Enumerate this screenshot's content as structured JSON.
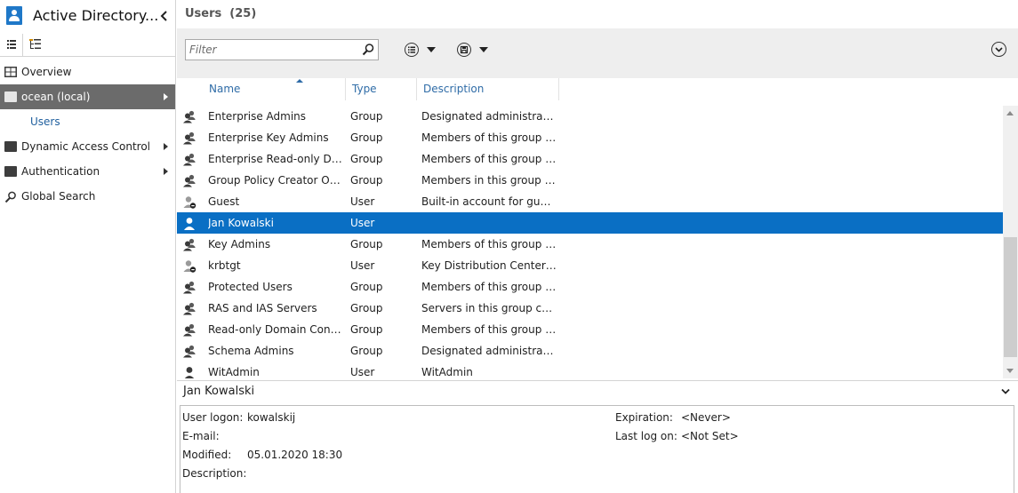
{
  "nav": {
    "title": "Active Directory...",
    "items": [
      {
        "label": "Overview"
      },
      {
        "label": "ocean (local)"
      },
      {
        "label": "Users"
      },
      {
        "label": "Dynamic Access Control"
      },
      {
        "label": "Authentication"
      },
      {
        "label": "Global Search"
      }
    ]
  },
  "header": {
    "title": "Users  (25)"
  },
  "toolbar": {
    "filter_placeholder": "Filter"
  },
  "columns": [
    "Name",
    "Type",
    "Description"
  ],
  "rows": [
    {
      "name": "Enterprise Admins",
      "type": "Group",
      "description": "Designated administrators...",
      "icon": "group-icon"
    },
    {
      "name": "Enterprise Key Admins",
      "type": "Group",
      "description": "Members of this group ca...",
      "icon": "group-icon"
    },
    {
      "name": "Enterprise Read-only Dom...",
      "type": "Group",
      "description": "Members of this group ar...",
      "icon": "group-icon"
    },
    {
      "name": "Group Policy Creator Own...",
      "type": "Group",
      "description": "Members in this group ca...",
      "icon": "group-icon"
    },
    {
      "name": "Guest",
      "type": "User",
      "description": "Built-in account for guest...",
      "icon": "disabled-user-icon"
    },
    {
      "name": "Jan Kowalski",
      "type": "User",
      "description": "",
      "icon": "user-icon",
      "selected": true
    },
    {
      "name": "Key Admins",
      "type": "Group",
      "description": "Members of this group ca...",
      "icon": "group-icon"
    },
    {
      "name": "krbtgt",
      "type": "User",
      "description": "Key Distribution Center Se...",
      "icon": "disabled-user-icon"
    },
    {
      "name": "Protected Users",
      "type": "Group",
      "description": "Members of this group ar...",
      "icon": "group-icon"
    },
    {
      "name": "RAS and IAS Servers",
      "type": "Group",
      "description": "Servers in this group can a...",
      "icon": "group-icon"
    },
    {
      "name": "Read-only Domain Control...",
      "type": "Group",
      "description": "Members of this group ar...",
      "icon": "group-icon"
    },
    {
      "name": "Schema Admins",
      "type": "Group",
      "description": "Designated administrators...",
      "icon": "group-icon"
    },
    {
      "name": "WitAdmin",
      "type": "User",
      "description": "WitAdmin",
      "icon": "user-icon"
    }
  ],
  "detail": {
    "title": "Jan Kowalski",
    "user_logon_label": "User logon:",
    "user_logon": "kowalskij",
    "email_label": "E-mail:",
    "email": "",
    "modified_label": "Modified:",
    "modified": "05.01.2020 18:30",
    "description_label": "Description:",
    "description": "",
    "expiration_label": "Expiration:",
    "expiration": "<Never>",
    "last_logon_label": "Last log on:",
    "last_logon": "<Not Set>"
  },
  "colors": {
    "selection": "#0a6fc4",
    "nav_selected": "#6b6b6b",
    "link": "#2f6ca7"
  }
}
